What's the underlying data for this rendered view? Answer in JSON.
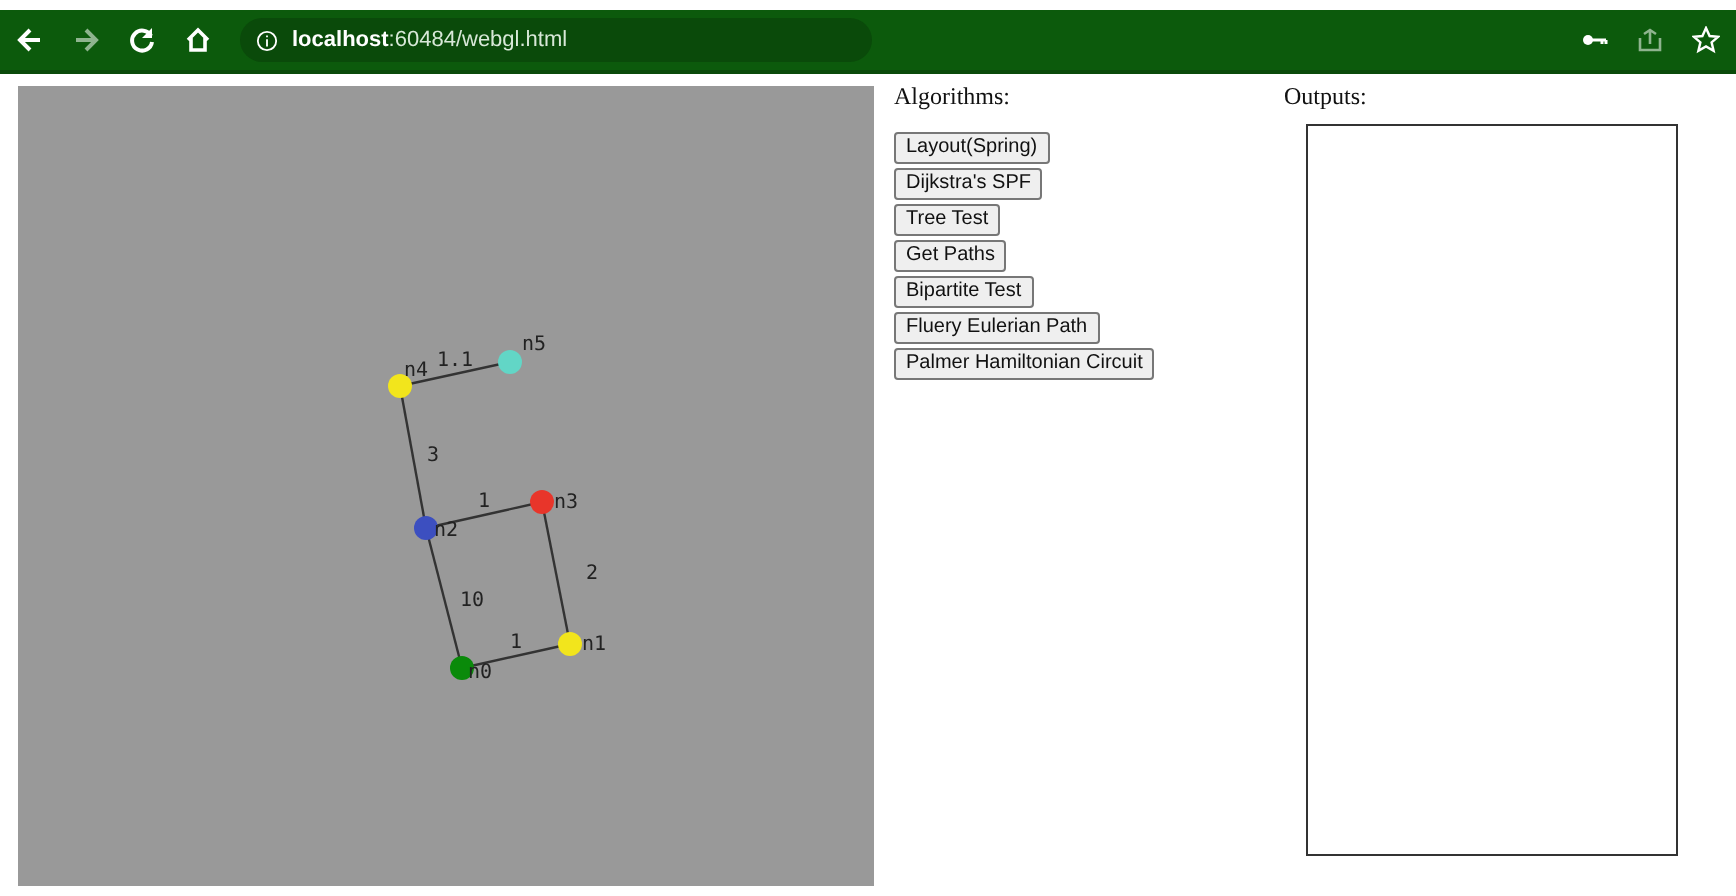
{
  "browser": {
    "url_host": "localhost",
    "url_rest": ":60484/webgl.html"
  },
  "graph": {
    "nodes": [
      {
        "label": "n0",
        "color": "#0a8a0a"
      },
      {
        "label": "n1",
        "color": "#f2e51c"
      },
      {
        "label": "n2",
        "color": "#3c4fc0"
      },
      {
        "label": "n3",
        "color": "#e8352a"
      },
      {
        "label": "n4",
        "color": "#f2e51c"
      },
      {
        "label": "n5",
        "color": "#62d6c6"
      }
    ],
    "edges": [
      {
        "weight": "1.1"
      },
      {
        "weight": "3"
      },
      {
        "weight": "1"
      },
      {
        "weight": "2"
      },
      {
        "weight": "10"
      },
      {
        "weight": "1"
      }
    ]
  },
  "algorithms": {
    "title": "Algorithms:",
    "buttons": [
      "Layout(Spring)",
      "Dijkstra's SPF",
      "Tree Test",
      "Get Paths",
      "Bipartite Test",
      "Fluery Eulerian Path",
      "Palmer Hamiltonian Circuit"
    ]
  },
  "outputs": {
    "title": "Outputs:"
  }
}
